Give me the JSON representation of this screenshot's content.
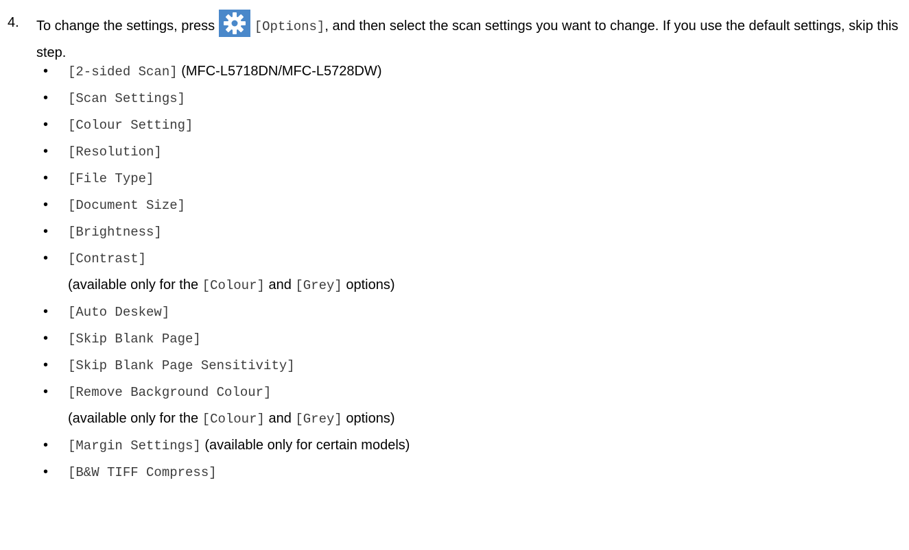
{
  "step": {
    "number": "4.",
    "text_before": "To change the settings, press ",
    "icon": "gear-icon",
    "icon_color": "#4a88ca",
    "button_label": "[Options]",
    "text_after": ", and then select the scan settings you want to change. If you use the default settings, skip this step."
  },
  "options": [
    {
      "label": "[2-sided Scan]",
      "note_inline": " (MFC-L5718DN/MFC-L5728DW)"
    },
    {
      "label": "[Scan Settings]"
    },
    {
      "label": "[Colour Setting]"
    },
    {
      "label": "[Resolution]"
    },
    {
      "label": "[File Type]"
    },
    {
      "label": "[Document Size]"
    },
    {
      "label": "[Brightness]"
    },
    {
      "label": "[Contrast]",
      "note": {
        "pre": "(available only for the ",
        "opt1": "[Colour]",
        "mid": " and ",
        "opt2": "[Grey]",
        "post": " options)"
      }
    },
    {
      "label": "[Auto Deskew]"
    },
    {
      "label": "[Skip Blank Page]"
    },
    {
      "label": "[Skip Blank Page Sensitivity]"
    },
    {
      "label": "[Remove Background Colour]",
      "note": {
        "pre": "(available only for the ",
        "opt1": "[Colour]",
        "mid": " and ",
        "opt2": "[Grey]",
        "post": " options)"
      }
    },
    {
      "label": "[Margin Settings]",
      "note_inline": " (available only for certain models)"
    },
    {
      "label": "[B&W TIFF Compress]"
    }
  ]
}
